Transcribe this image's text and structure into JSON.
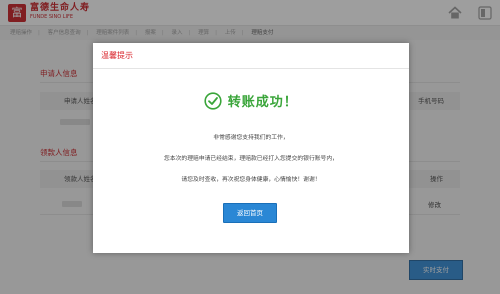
{
  "header": {
    "logo_char": "富",
    "brand_cn": "富德生命人寿",
    "brand_en": "FUNDE SINO LIFE"
  },
  "breadcrumb": {
    "items": [
      "理赔操作",
      "客户信息查询",
      "理赔案件列表",
      "报案",
      "录入",
      "理算",
      "上传",
      "理赔支付"
    ]
  },
  "background": {
    "applicant_section_title": "申请人信息",
    "applicant_col_name": "申请人姓名",
    "applicant_col_phone": "手机号码",
    "payee_section_title": "领款人信息",
    "payee_col_name": "领款人姓名",
    "payee_col_action": "操作",
    "payee_row_action": "修改",
    "pay_button": "实时支付"
  },
  "modal": {
    "title": "温馨提示",
    "success_text": "转账成功！",
    "message_1": "非常感谢您支持我们的工作，",
    "message_2": "您本次的理赔申请已经结束，理赔款已经打入您提交的银行账号内，",
    "message_3": "请您及时查收，再次祝您身体健康，心情愉快！谢谢！",
    "back_button": "返回首页"
  },
  "colors": {
    "brand_red": "#c8161d",
    "success_green": "#3aa53a",
    "primary_blue": "#2a87d5"
  },
  "icons": {
    "home": "home-icon",
    "toggle": "toggle-icon",
    "success": "check-circle-icon"
  }
}
